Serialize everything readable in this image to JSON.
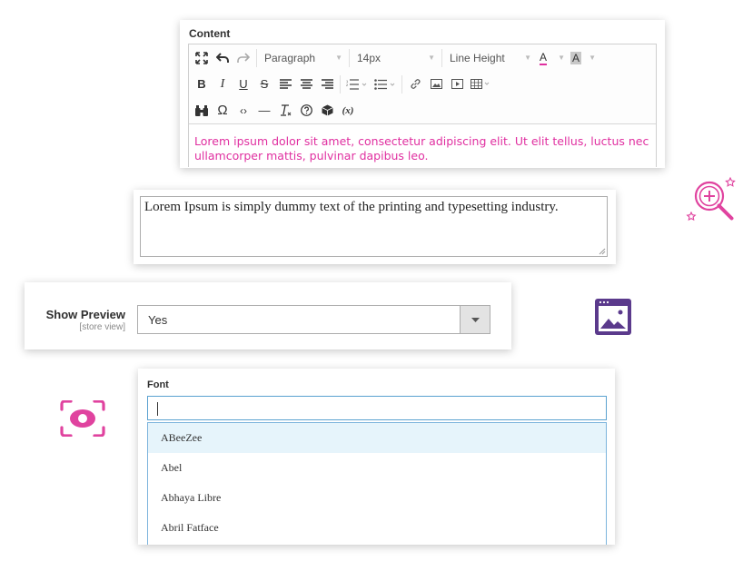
{
  "editor": {
    "title": "Content",
    "toolbar": {
      "block_format": "Paragraph",
      "font_size": "14px",
      "line_height": "Line Height",
      "text_color_letter": "A",
      "bg_color_letter": "A",
      "omega_glyph": "Ω",
      "code_glyph": "‹›",
      "hr_glyph": "—",
      "variable_glyph": "(x)"
    },
    "body_text": "Lorem ipsum dolor sit amet, consectetur adipiscing elit. Ut elit tellus, luctus nec ullamcorper mattis, pulvinar dapibus leo.",
    "colors": {
      "accent_text": "#e02fa0"
    }
  },
  "textarea": {
    "value": "Lorem Ipsum is simply dummy text of the printing and typesetting industry."
  },
  "preview": {
    "label": "Show Preview",
    "scope": "[store view]",
    "selected": "Yes"
  },
  "font": {
    "label": "Font",
    "input_value": "",
    "options": [
      "ABeeZee",
      "Abel",
      "Abhaya Libre",
      "Abril Fatface"
    ]
  },
  "icons": {
    "zoom": "magnify-plus-sparkle-icon",
    "image": "image-window-icon",
    "eye": "eye-focus-icon",
    "colors": {
      "pink": "#e0439f",
      "purple": "#5b3a8c"
    }
  }
}
